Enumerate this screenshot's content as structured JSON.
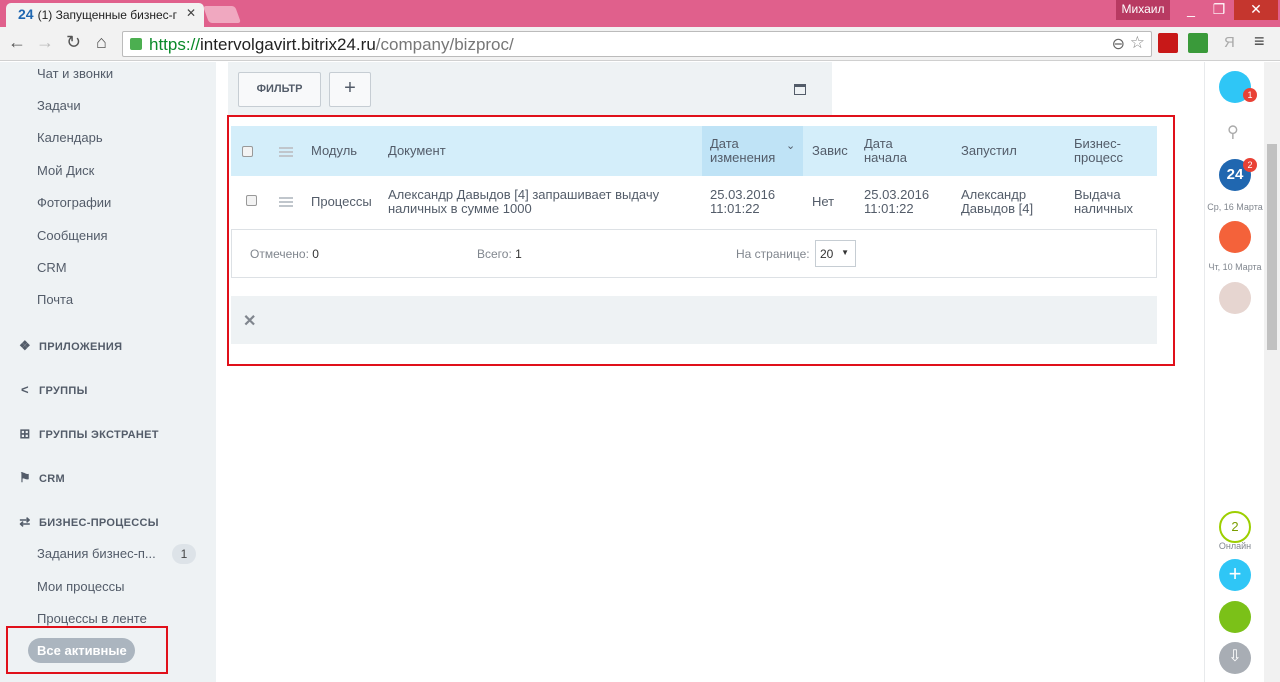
{
  "browser": {
    "tab_title": "(1) Запущенные бизнес-г",
    "tab_logo": "24",
    "user_name": "Михаил",
    "url_protocol": "https://",
    "url_host": "intervolgavirt.bitrix24.ru",
    "url_path": "/company/bizproc/"
  },
  "sidebar": {
    "items": [
      "Чат и звонки",
      "Задачи",
      "Календарь",
      "Мой Диск",
      "Фотографии",
      "Сообщения",
      "CRM",
      "Почта"
    ],
    "groups": [
      "ПРИЛОЖЕНИЯ",
      "ГРУППЫ",
      "ГРУППЫ ЭКСТРАНЕТ",
      "CRM",
      "БИЗНЕС-ПРОЦЕССЫ"
    ],
    "bp_items": [
      "Задания бизнес-п...",
      "Мои процессы",
      "Процессы в ленте"
    ],
    "bp_counter": "1",
    "active_item": "Все активные"
  },
  "toolbar": {
    "filter_label": "ФИЛЬТР",
    "add_label": "+"
  },
  "grid": {
    "headers": {
      "module": "Модуль",
      "document": "Документ",
      "modified_1": "Дата",
      "modified_2": "изменения",
      "depends": "Завис",
      "started_1": "Дата",
      "started_2": "начала",
      "started_by": "Запустил",
      "bp_1": "Бизнес-",
      "bp_2": "процесс"
    },
    "rows": [
      {
        "module": "Процессы",
        "document_1": "Александр Давыдов [4] запрашивает выдачу",
        "document_2": "наличных в сумме 1000",
        "modified_1": "25.03.2016",
        "modified_2": "11:01:22",
        "depends": "Нет",
        "started_1": "25.03.2016",
        "started_2": "11:01:22",
        "started_by_1": "Александр",
        "started_by_2": "Давыдов [4]",
        "bp_1": "Выдача",
        "bp_2": "наличных"
      }
    ],
    "footer": {
      "selected_label": "Отмечено:",
      "selected_value": "0",
      "total_label": "Всего:",
      "total_value": "1",
      "per_page_label": "На странице:",
      "per_page_value": "20"
    }
  },
  "rightbar": {
    "notif_badge": "1",
    "chat_badge": "2",
    "logo": "24",
    "date_1": "Ср, 16 Марта",
    "date_2": "Чт, 10 Марта",
    "online_count": "2",
    "online_label": "Онлайн"
  },
  "colors": {
    "title_bar": "#e0608c",
    "highlight_border": "#e0101a",
    "grid_header": "#d4eefa"
  }
}
